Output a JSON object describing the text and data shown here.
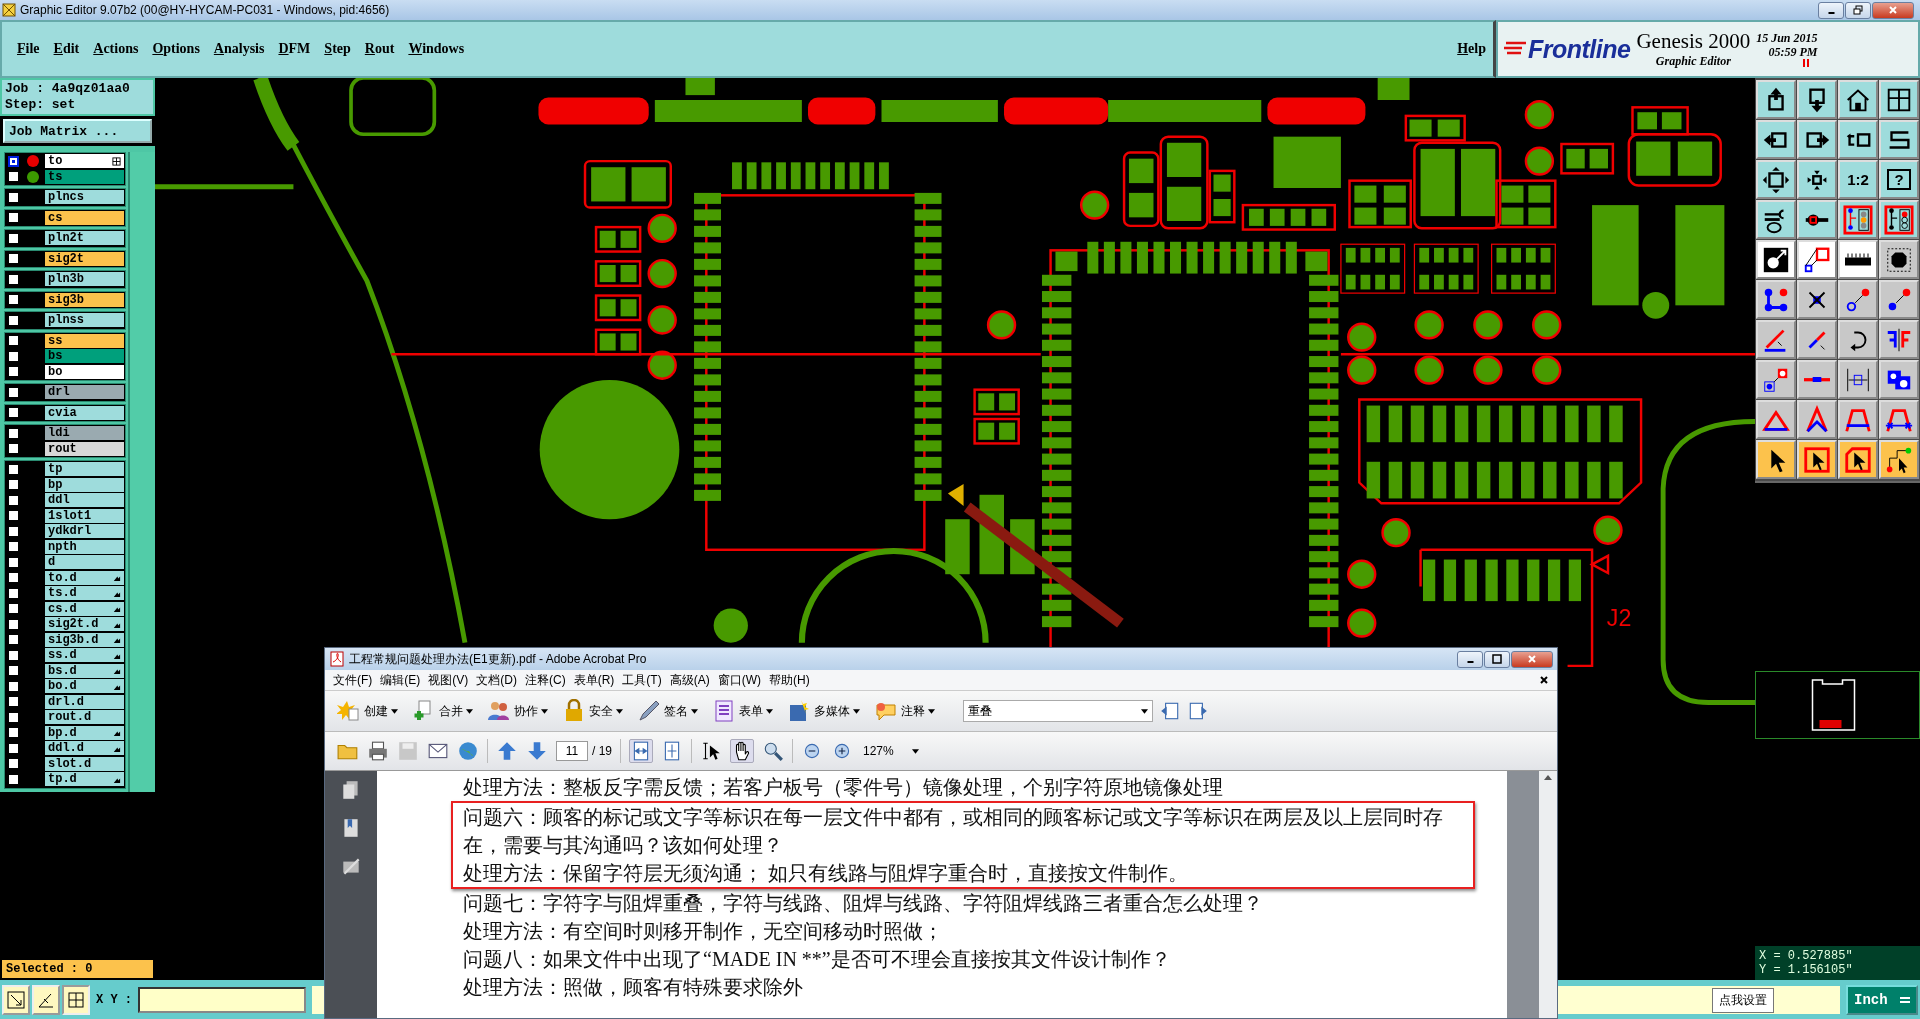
{
  "app_window": {
    "title": "Graphic Editor 9.07b2 (00@HY-HYCAM-PC031 - Windows, pid:4656)"
  },
  "menu": [
    {
      "label": "File"
    },
    {
      "label": "Edit"
    },
    {
      "label": "Actions"
    },
    {
      "label": "Options"
    },
    {
      "label": "Analysis"
    },
    {
      "label": "DFM"
    },
    {
      "label": "Step"
    },
    {
      "label": "Rout"
    },
    {
      "label": "Windows"
    }
  ],
  "help": "Help",
  "brand": {
    "logo": "Frontline",
    "product": "Genesis 2000",
    "subtitle": "Graphic Editor",
    "date": "15 Jun 2015",
    "time": "05:59 PM"
  },
  "job": {
    "job": "Job : 4a9qz01aa0",
    "step": "Step: set",
    "matrix_button": "Job Matrix ..."
  },
  "layer_groups": [
    [
      {
        "name": "to",
        "color": "#ffffff",
        "dot": {
          "color": "#e80000"
        },
        "kind": "grid",
        "active": true
      },
      {
        "name": "ts",
        "color": "#00a07c",
        "dot": {
          "color": "#3c9a00"
        },
        "kind": "plain",
        "active": false
      }
    ],
    [
      {
        "name": "plncs",
        "color": "#9edcdc",
        "active": false
      }
    ],
    [
      {
        "name": "cs",
        "color": "#fcc24c",
        "active": false
      }
    ],
    [
      {
        "name": "pln2t",
        "color": "#9edcdc",
        "active": false
      }
    ],
    [
      {
        "name": "sig2t",
        "color": "#fcc24c",
        "active": false
      }
    ],
    [
      {
        "name": "pln3b",
        "color": "#9edcdc",
        "active": false
      }
    ],
    [
      {
        "name": "sig3b",
        "color": "#fcc24c",
        "active": false
      }
    ],
    [
      {
        "name": "plnss",
        "color": "#9edcdc",
        "active": false
      }
    ],
    [
      {
        "name": "ss",
        "color": "#fcc24c",
        "active": false
      },
      {
        "name": "bs",
        "color": "#00a07c",
        "active": false
      },
      {
        "name": "bo",
        "color": "#ffffff",
        "active": false
      }
    ],
    [
      {
        "name": "drl",
        "color": "#9aaab0",
        "active": false
      }
    ],
    [
      {
        "name": "cvia",
        "color": "#9edcdc",
        "active": false
      }
    ],
    [
      {
        "name": "ldi",
        "color": "#9aaab0",
        "active": false
      },
      {
        "name": "rout",
        "color": "#d8d8d8",
        "active": false
      }
    ],
    [
      {
        "name": "tp",
        "color": "#9edcdc",
        "active": false
      },
      {
        "name": "bp",
        "color": "#9edcdc",
        "active": false
      },
      {
        "name": "ddl",
        "color": "#9edcdc",
        "active": false
      },
      {
        "name": "1slot1",
        "color": "#9edcdc",
        "active": false
      },
      {
        "name": "ydkdrl",
        "color": "#9edcdc",
        "active": false
      },
      {
        "name": "npth",
        "color": "#9edcdc",
        "active": false
      },
      {
        "name": "d",
        "color": "#9edcdc",
        "active": false
      },
      {
        "name": "to.d",
        "color": "#9edcdc",
        "kind": "linked",
        "active": false
      },
      {
        "name": "ts.d",
        "color": "#9edcdc",
        "kind": "linked",
        "active": false
      },
      {
        "name": "cs.d",
        "color": "#9edcdc",
        "kind": "linked",
        "active": false
      },
      {
        "name": "sig2t.d",
        "color": "#9edcdc",
        "kind": "linked",
        "active": false
      },
      {
        "name": "sig3b.d",
        "color": "#9edcdc",
        "kind": "linked",
        "active": false
      },
      {
        "name": "ss.d",
        "color": "#9edcdc",
        "kind": "linked",
        "active": false
      },
      {
        "name": "bs.d",
        "color": "#9edcdc",
        "kind": "linked",
        "active": false
      },
      {
        "name": "bo.d",
        "color": "#9edcdc",
        "kind": "linked",
        "active": false
      },
      {
        "name": "drl.d",
        "color": "#9edcdc",
        "active": false
      },
      {
        "name": "rout.d",
        "color": "#9edcdc",
        "active": false
      },
      {
        "name": "bp.d",
        "color": "#9edcdc",
        "kind": "linked",
        "active": false
      },
      {
        "name": "ddl.d",
        "color": "#9edcdc",
        "kind": "linked",
        "active": false
      },
      {
        "name": "slot.d",
        "color": "#9edcdc",
        "active": false
      },
      {
        "name": "tp.d",
        "color": "#9edcdc",
        "kind": "linked",
        "active": false
      }
    ]
  ],
  "selected": "Selected : 0",
  "canvas": {
    "label": "J2"
  },
  "tool_palette": {
    "ratio": "1:2",
    "help": "?"
  },
  "coordinates": {
    "x": "X = 0.527885\"",
    "y": "Y = 1.156105\""
  },
  "bottom_bar": {
    "xy_label": "X Y :",
    "units": "Inch"
  },
  "tooltip": "点我设置",
  "pdf": {
    "title": "工程常规问题处理办法(E1更新).pdf - Adobe Acrobat Pro",
    "menu": [
      "文件(F)",
      "编辑(E)",
      "视图(V)",
      "文档(D)",
      "注释(C)",
      "表单(R)",
      "工具(T)",
      "高级(A)",
      "窗口(W)",
      "帮助(H)"
    ],
    "tools": [
      {
        "label": "创建",
        "kind": "create"
      },
      {
        "label": "合并",
        "kind": "merge"
      },
      {
        "label": "协作",
        "kind": "collaborate"
      },
      {
        "label": "安全",
        "kind": "security"
      },
      {
        "label": "签名",
        "kind": "sign"
      },
      {
        "label": "表单",
        "kind": "form"
      },
      {
        "label": "多媒体",
        "kind": "media"
      },
      {
        "label": "注释",
        "kind": "comment"
      }
    ],
    "view_mode": "重叠",
    "page": "11",
    "page_total": "/ 19",
    "zoom": "127%",
    "lines": [
      {
        "text": "处理方法：整板反字需反馈；若客户板号（零件号）镜像处理，个别字符原地镜像处理",
        "highlighted": false
      },
      {
        "text": "问题六：顾客的标记或文字等标识在每一层文件中都有，或相同的顾客标记或文字等标识在两层及以上层同时存在，需要与其沟通吗？该如何处理？",
        "highlighted": true
      },
      {
        "text": "处理方法：保留字符层无须沟通；  如只有线路与阻焊字重合时，直接按文件制作。",
        "highlighted": true
      },
      {
        "text": "问题七：字符字与阻焊重叠，字符与线路、阻焊与线路、字符阻焊线路三者重合怎么处理？",
        "highlighted": false
      },
      {
        "text": "处理方法：有空间时则移开制作，无空间移动时照做；",
        "highlighted": false
      },
      {
        "text": "问题八：如果文件中出现了“MADE IN **”是否可不理会直接按其文件设计制作？",
        "highlighted": false
      },
      {
        "text": "处理方法：照做，顾客有特殊要求除外",
        "highlighted": false
      }
    ]
  }
}
